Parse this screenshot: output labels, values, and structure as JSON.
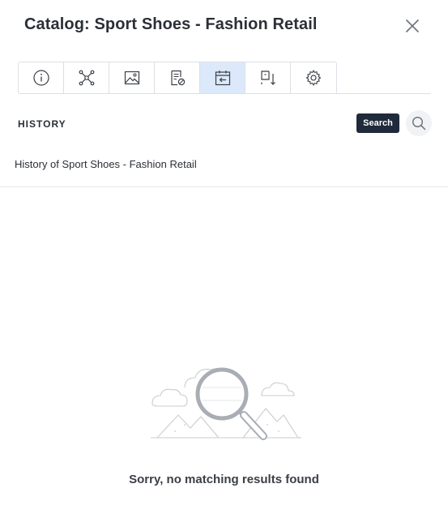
{
  "header": {
    "title": "Catalog: Sport Shoes - Fashion Retail",
    "close_icon": "close-icon"
  },
  "toolbar": {
    "buttons": [
      {
        "icon": "info-icon",
        "active": false
      },
      {
        "icon": "network-icon",
        "active": false
      },
      {
        "icon": "image-icon",
        "active": false
      },
      {
        "icon": "document-edit-icon",
        "active": false
      },
      {
        "icon": "calendar-history-icon",
        "active": true
      },
      {
        "icon": "sort-download-icon",
        "active": false
      },
      {
        "icon": "settings-gear-icon",
        "active": false
      }
    ],
    "active_color": "#dce9fb"
  },
  "section": {
    "title": "HISTORY",
    "search_tooltip": "Search",
    "search_icon": "search-icon"
  },
  "subtitle": "History of Sport Shoes - Fashion Retail",
  "empty_state": {
    "message": "Sorry, no matching results found",
    "illustration": "magnifier-mountains-icon"
  }
}
